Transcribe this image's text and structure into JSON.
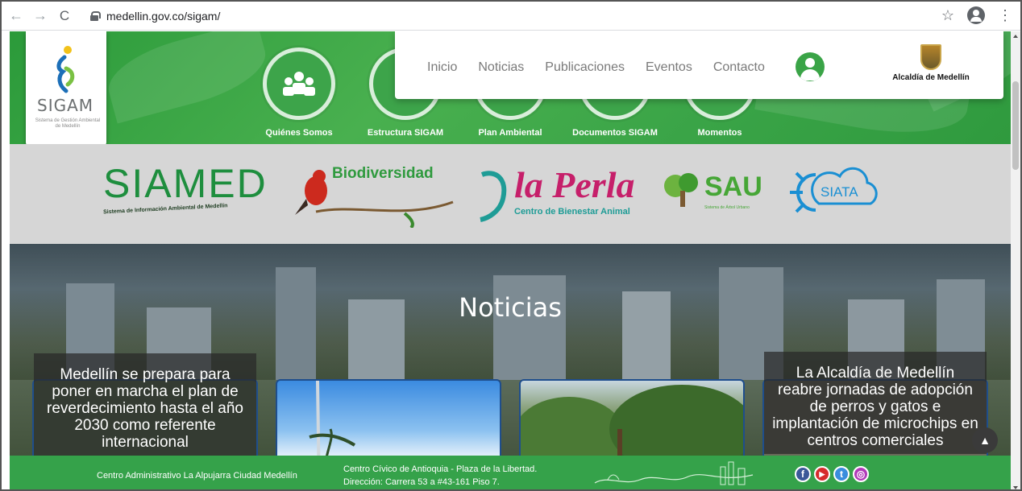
{
  "browser": {
    "url": "medellin.gov.co/sigam/",
    "back_icon": "←",
    "forward_icon": "→",
    "reload_icon": "C",
    "star_icon": "☆",
    "menu_icon": "⋮"
  },
  "brand": {
    "logo_text": "SIGAM",
    "logo_sub": "Sistema de Gestión Ambiental de Medellín"
  },
  "quick_links": [
    {
      "label": "Quiénes Somos",
      "icon": "people-icon"
    },
    {
      "label": "Estructura SIGAM",
      "icon": "structure-icon"
    },
    {
      "label": "Plan Ambiental",
      "icon": "plant-icon"
    },
    {
      "label": "Documentos SIGAM",
      "icon": "document-icon"
    },
    {
      "label": "Momentos",
      "icon": "camera-icon"
    }
  ],
  "nav": {
    "items": [
      "Inicio",
      "Noticias",
      "Publicaciones",
      "Eventos",
      "Contacto"
    ],
    "alcaldia_label": "Alcaldía de Medellín"
  },
  "partners": {
    "siamed_title": "SIAMED",
    "siamed_sub": "Sistema de Información Ambiental de Medellín",
    "bio_title": "Biodiversidad",
    "perla_title": "la Perla",
    "perla_sub": "Centro de Bienestar Animal",
    "sau_title": "SAU",
    "sau_sub": "Sistema de Árbol Urbano",
    "siata_title": "SIATA"
  },
  "news": {
    "heading": "Noticias",
    "cards": [
      {
        "caption": "Medellín se prepara para poner en marcha el plan de reverdecimiento hasta el año 2030 como referente internacional"
      },
      {
        "caption": ""
      },
      {
        "caption": ""
      },
      {
        "caption": "La Alcaldía de Medellín reabre jornadas de adopción de perros y gatos e implantación de microchips en centros comerciales"
      }
    ]
  },
  "footer": {
    "address_1": "Centro Administrativo La Alpujarra Ciudad Medellín",
    "address_2_line1": "Centro Cívico de Antioquia - Plaza de la Libertad.",
    "address_2_line2": "Dirección: Carrera 53 a #43-161 Piso 7.",
    "social": [
      {
        "name": "facebook",
        "glyph": "f",
        "color": "#3b5998"
      },
      {
        "name": "youtube",
        "glyph": "▶",
        "color": "#d62b2b"
      },
      {
        "name": "twitter",
        "glyph": "t",
        "color": "#3a8ddd"
      },
      {
        "name": "instagram",
        "glyph": "◎",
        "color": "#b03ab8"
      }
    ]
  },
  "colors": {
    "header_green": "#3aa447",
    "footer_green": "#35a24a",
    "band_grey": "#d6d6d6"
  }
}
